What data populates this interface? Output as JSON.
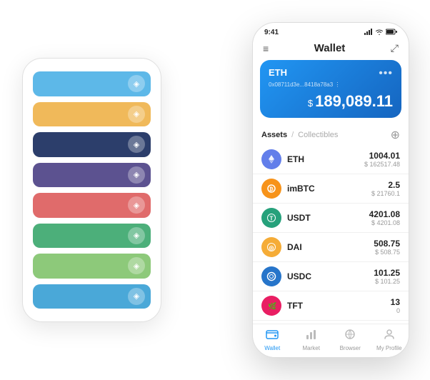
{
  "scene": {
    "bg_phone": {
      "cards": [
        {
          "color": "#5DB8E8",
          "icon": "◈"
        },
        {
          "color": "#F0B95A",
          "icon": "◈"
        },
        {
          "color": "#2C3E6B",
          "icon": "◈"
        },
        {
          "color": "#5C5290",
          "icon": "◈"
        },
        {
          "color": "#E06B6B",
          "icon": "◈"
        },
        {
          "color": "#4CAF7A",
          "icon": "◈"
        },
        {
          "color": "#8DC97A",
          "icon": "◈"
        },
        {
          "color": "#4AA8D8",
          "icon": "◈"
        }
      ]
    },
    "fg_phone": {
      "status_bar": {
        "time": "9:41",
        "battery": "▌",
        "wifi": "wifi",
        "signal": "signal"
      },
      "header": {
        "menu_icon": "≡",
        "title": "Wallet",
        "expand_icon": "⤢"
      },
      "eth_card": {
        "label": "ETH",
        "dots": "•••",
        "address": "0x08711d3e...8418a78a3 ⋮",
        "symbol": "$",
        "amount": "189,089.11"
      },
      "assets_section": {
        "tab_active": "Assets",
        "divider": "/",
        "tab_inactive": "Collectibles",
        "add_icon": "⊕"
      },
      "assets": [
        {
          "name": "ETH",
          "icon_bg": "#627EEA",
          "icon_color": "#fff",
          "icon_text": "♦",
          "amount": "1004.01",
          "usd": "$ 162517.48"
        },
        {
          "name": "imBTC",
          "icon_bg": "#F7931A",
          "icon_color": "#fff",
          "icon_text": "⊙",
          "amount": "2.5",
          "usd": "$ 21760.1"
        },
        {
          "name": "USDT",
          "icon_bg": "#26A17B",
          "icon_color": "#fff",
          "icon_text": "T",
          "amount": "4201.08",
          "usd": "$ 4201.08"
        },
        {
          "name": "DAI",
          "icon_bg": "#F5AC37",
          "icon_color": "#fff",
          "icon_text": "◎",
          "amount": "508.75",
          "usd": "$ 508.75"
        },
        {
          "name": "USDC",
          "icon_bg": "#2775CA",
          "icon_color": "#fff",
          "icon_text": "⊛",
          "amount": "101.25",
          "usd": "$ 101.25"
        },
        {
          "name": "TFT",
          "icon_bg": "#E91E63",
          "icon_color": "#fff",
          "icon_text": "🌿",
          "amount": "13",
          "usd": "0"
        }
      ],
      "bottom_nav": [
        {
          "label": "Wallet",
          "icon": "⬡",
          "active": true
        },
        {
          "label": "Market",
          "icon": "📊",
          "active": false
        },
        {
          "label": "Browser",
          "icon": "👤",
          "active": false
        },
        {
          "label": "My Profile",
          "icon": "👤",
          "active": false
        }
      ]
    }
  }
}
